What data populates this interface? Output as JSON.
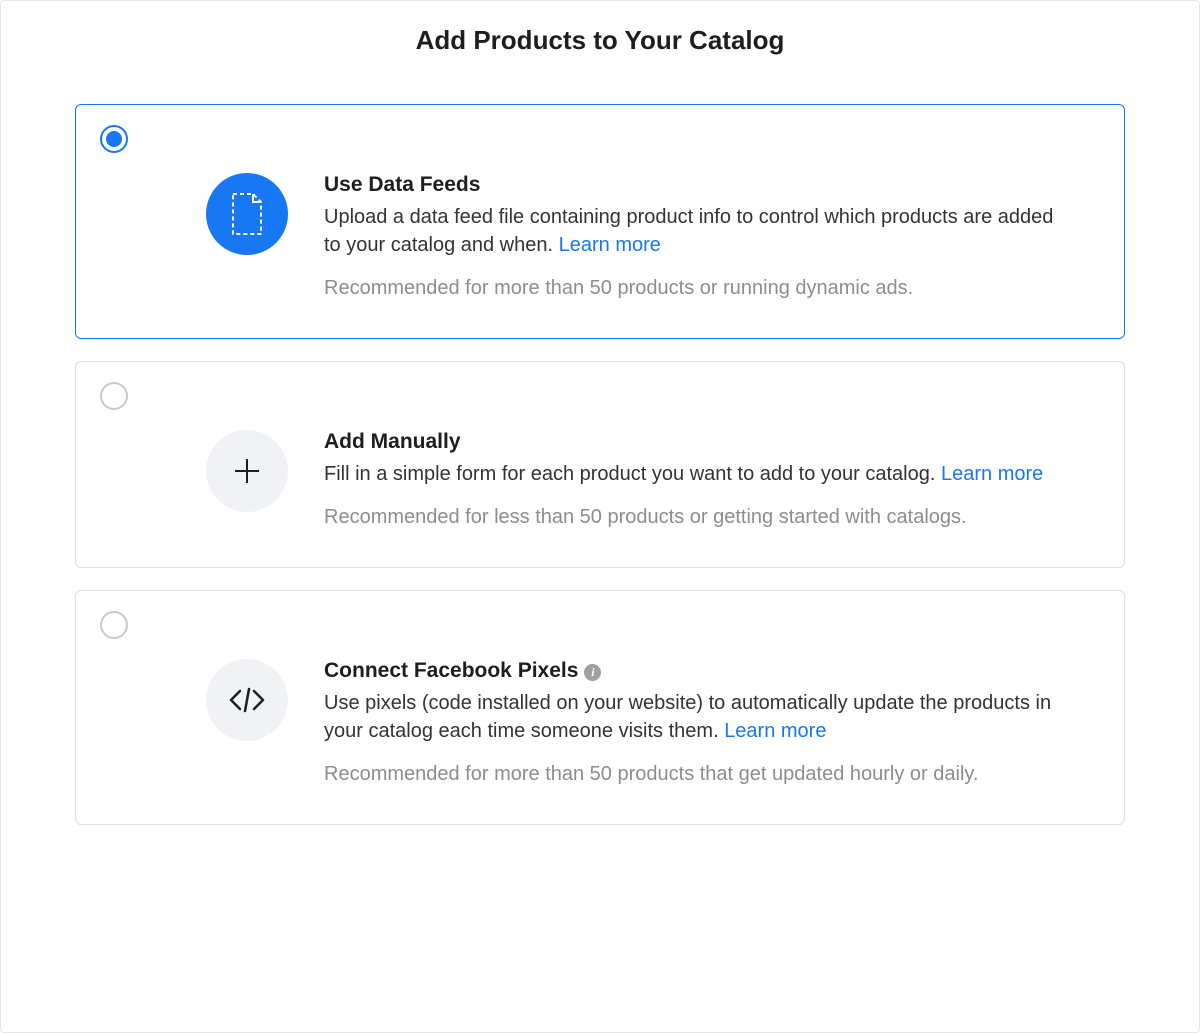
{
  "page": {
    "title": "Add Products to Your Catalog"
  },
  "options": [
    {
      "id": "data-feeds",
      "selected": true,
      "icon": "file",
      "title": "Use Data Feeds",
      "description": "Upload a data feed file containing product info to control which products are added to your catalog and when. ",
      "learn_more": "Learn more",
      "recommendation": "Recommended for more than 50 products or running dynamic ads.",
      "has_info": false
    },
    {
      "id": "add-manually",
      "selected": false,
      "icon": "plus",
      "title": "Add Manually",
      "description": "Fill in a simple form for each product you want to add to your catalog. ",
      "learn_more": "Learn more",
      "recommendation": "Recommended for less than 50 products or getting started with catalogs.",
      "has_info": false
    },
    {
      "id": "connect-pixels",
      "selected": false,
      "icon": "code",
      "title": "Connect Facebook Pixels",
      "description": "Use pixels (code installed on your website) to automatically update the products in your catalog each time someone visits them. ",
      "learn_more": "Learn more",
      "recommendation": "Recommended for more than 50 products that get updated hourly or daily.",
      "has_info": true
    }
  ]
}
